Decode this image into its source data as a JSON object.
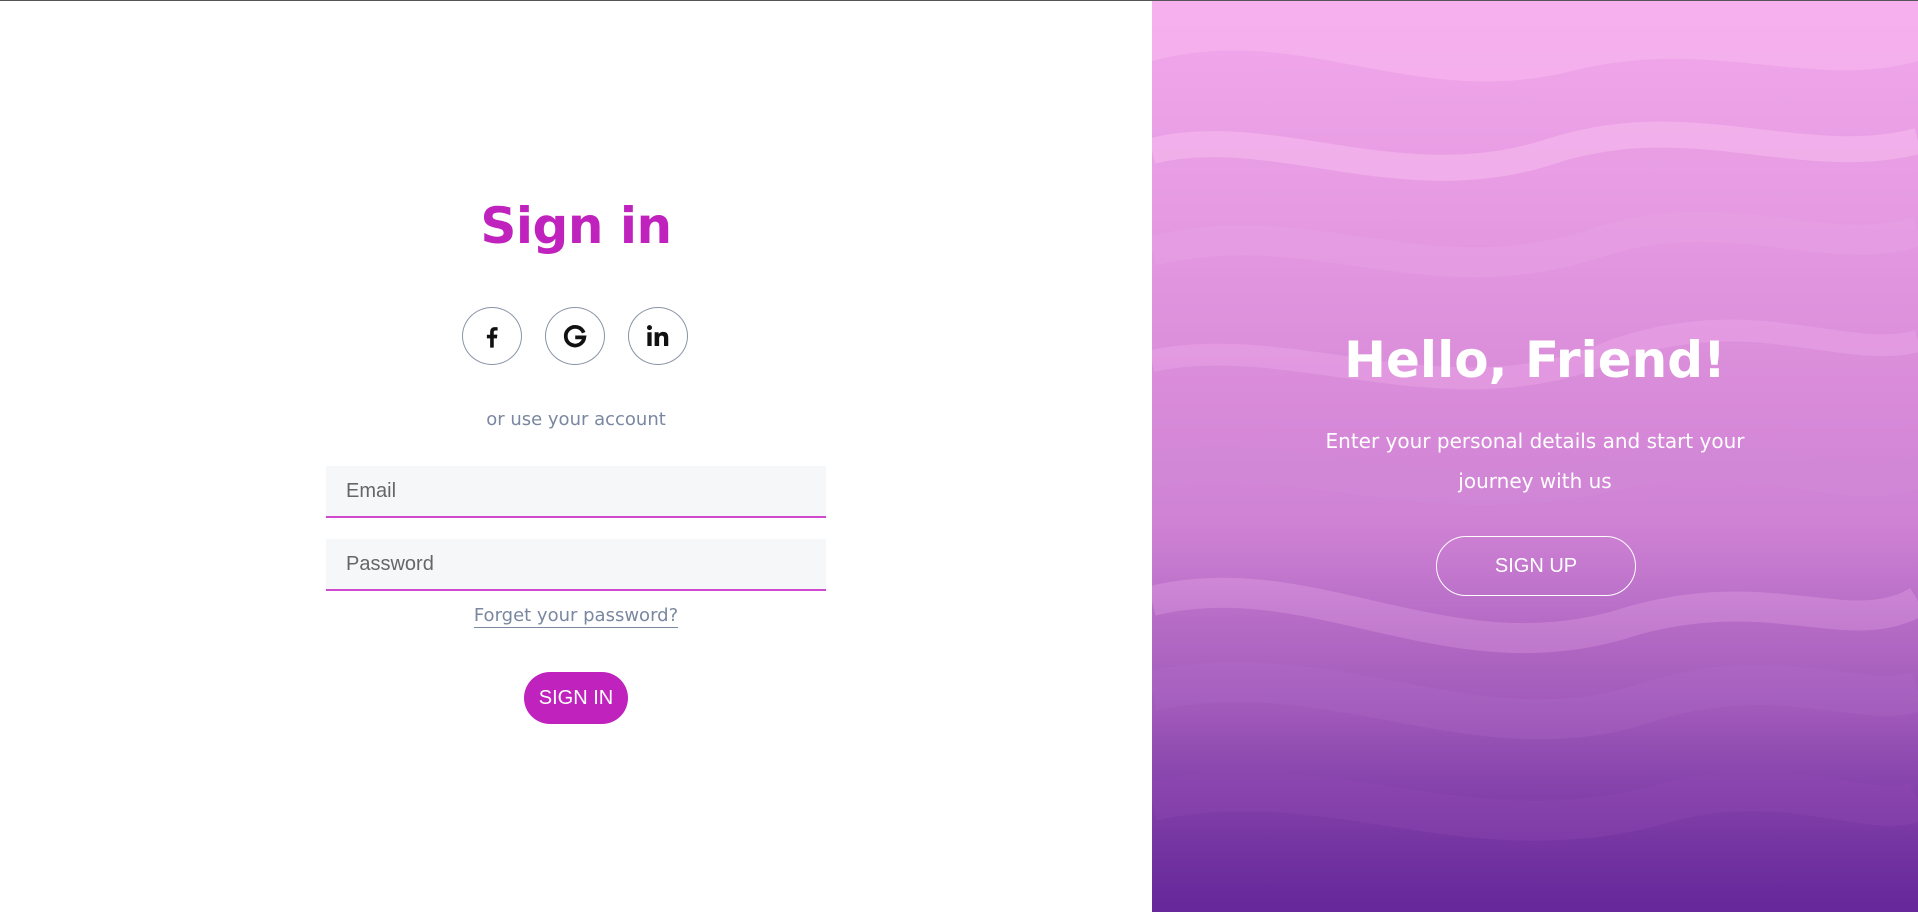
{
  "signin": {
    "title": "Sign in",
    "social": [
      {
        "name": "facebook-icon"
      },
      {
        "name": "google-icon"
      },
      {
        "name": "linkedin-icon"
      }
    ],
    "separator_text": "or use your account",
    "email_placeholder": "Email",
    "password_placeholder": "Password",
    "forgot_link": "Forget your password?",
    "submit_label": "SIGN IN"
  },
  "overlay": {
    "title": "Hello, Friend!",
    "text": "Enter your personal details and start your journey with us",
    "signup_label": "SIGN UP"
  },
  "colors": {
    "accent": "#c023bd",
    "muted_text": "#7a87a0",
    "field_bg": "#f6f7f9"
  }
}
